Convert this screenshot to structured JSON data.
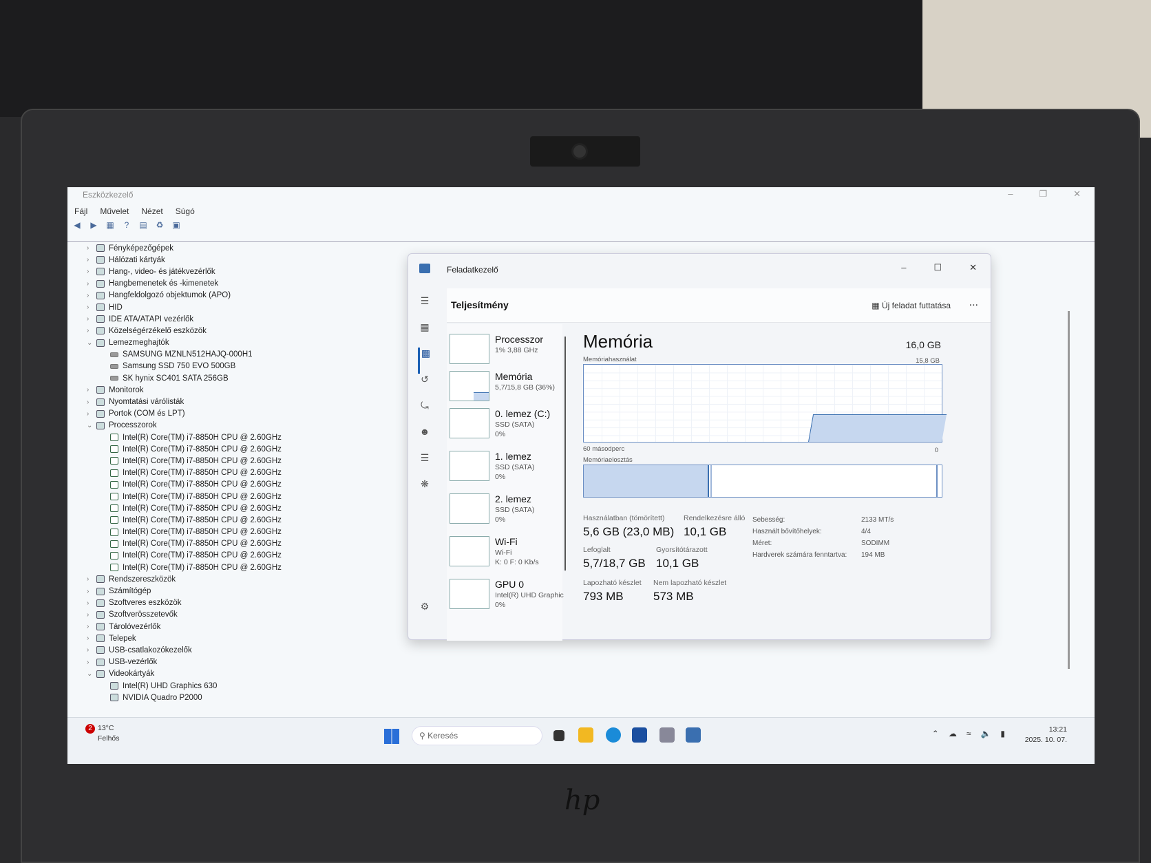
{
  "device_manager": {
    "title": "Eszközkezelő",
    "menu": [
      "Fájl",
      "Művelet",
      "Nézet",
      "Súgó"
    ],
    "tree": [
      {
        "label": "Fényképezőgépek",
        "level": 0,
        "expanded": false
      },
      {
        "label": "Hálózati kártyák",
        "level": 0,
        "expanded": false
      },
      {
        "label": "Hang-, video- és játékvezérlők",
        "level": 0,
        "expanded": false
      },
      {
        "label": "Hangbemenetek és -kimenetek",
        "level": 0,
        "expanded": false
      },
      {
        "label": "Hangfeldolgozó objektumok (APO)",
        "level": 0,
        "expanded": false
      },
      {
        "label": "HID",
        "level": 0,
        "expanded": false
      },
      {
        "label": "IDE ATA/ATAPI vezérlők",
        "level": 0,
        "expanded": false
      },
      {
        "label": "Közelségérzékelő eszközök",
        "level": 0,
        "expanded": false
      },
      {
        "label": "Lemezmeghajtók",
        "level": 0,
        "expanded": true
      },
      {
        "label": "SAMSUNG MZNLN512HAJQ-000H1",
        "level": 1,
        "icon": "disk"
      },
      {
        "label": "Samsung SSD 750 EVO 500GB",
        "level": 1,
        "icon": "disk"
      },
      {
        "label": "SK hynix SC401 SATA 256GB",
        "level": 1,
        "icon": "disk"
      },
      {
        "label": "Monitorok",
        "level": 0,
        "expanded": false
      },
      {
        "label": "Nyomtatási várólisták",
        "level": 0,
        "expanded": false
      },
      {
        "label": "Portok (COM és LPT)",
        "level": 0,
        "expanded": false
      },
      {
        "label": "Processzorok",
        "level": 0,
        "expanded": true
      },
      {
        "label": "Intel(R) Core(TM) i7-8850H CPU @ 2.60GHz",
        "level": 1,
        "icon": "cpu"
      },
      {
        "label": "Intel(R) Core(TM) i7-8850H CPU @ 2.60GHz",
        "level": 1,
        "icon": "cpu"
      },
      {
        "label": "Intel(R) Core(TM) i7-8850H CPU @ 2.60GHz",
        "level": 1,
        "icon": "cpu"
      },
      {
        "label": "Intel(R) Core(TM) i7-8850H CPU @ 2.60GHz",
        "level": 1,
        "icon": "cpu"
      },
      {
        "label": "Intel(R) Core(TM) i7-8850H CPU @ 2.60GHz",
        "level": 1,
        "icon": "cpu"
      },
      {
        "label": "Intel(R) Core(TM) i7-8850H CPU @ 2.60GHz",
        "level": 1,
        "icon": "cpu"
      },
      {
        "label": "Intel(R) Core(TM) i7-8850H CPU @ 2.60GHz",
        "level": 1,
        "icon": "cpu"
      },
      {
        "label": "Intel(R) Core(TM) i7-8850H CPU @ 2.60GHz",
        "level": 1,
        "icon": "cpu"
      },
      {
        "label": "Intel(R) Core(TM) i7-8850H CPU @ 2.60GHz",
        "level": 1,
        "icon": "cpu"
      },
      {
        "label": "Intel(R) Core(TM) i7-8850H CPU @ 2.60GHz",
        "level": 1,
        "icon": "cpu"
      },
      {
        "label": "Intel(R) Core(TM) i7-8850H CPU @ 2.60GHz",
        "level": 1,
        "icon": "cpu"
      },
      {
        "label": "Intel(R) Core(TM) i7-8850H CPU @ 2.60GHz",
        "level": 1,
        "icon": "cpu"
      },
      {
        "label": "Rendszereszközök",
        "level": 0,
        "expanded": false
      },
      {
        "label": "Számítógép",
        "level": 0,
        "expanded": false
      },
      {
        "label": "Szoftveres eszközök",
        "level": 0,
        "expanded": false
      },
      {
        "label": "Szoftverösszetevők",
        "level": 0,
        "expanded": false
      },
      {
        "label": "Tárolóvezérlők",
        "level": 0,
        "expanded": false
      },
      {
        "label": "Telepek",
        "level": 0,
        "expanded": false
      },
      {
        "label": "USB-csatlakozókezelők",
        "level": 0,
        "expanded": false
      },
      {
        "label": "USB-vezérlők",
        "level": 0,
        "expanded": false
      },
      {
        "label": "Videokártyák",
        "level": 0,
        "expanded": true
      },
      {
        "label": "Intel(R) UHD Graphics 630",
        "level": 1,
        "icon": "monitor"
      },
      {
        "label": "NVIDIA Quadro P2000",
        "level": 1,
        "icon": "monitor"
      }
    ]
  },
  "task_manager": {
    "title": "Feladatkezelő",
    "section_title": "Teljesítmény",
    "run_task_label": "Új feladat futtatása",
    "more": "...",
    "items": [
      {
        "name": "Processzor",
        "sub1": "1% 3,88 GHz",
        "sub2": ""
      },
      {
        "name": "Memória",
        "sub1": "5,7/15,8 GB (36%)",
        "sub2": ""
      },
      {
        "name": "0. lemez (C:)",
        "sub1": "SSD (SATA)",
        "sub2": "0%"
      },
      {
        "name": "1. lemez",
        "sub1": "SSD (SATA)",
        "sub2": "0%"
      },
      {
        "name": "2. lemez",
        "sub1": "SSD (SATA)",
        "sub2": "0%"
      },
      {
        "name": "Wi-Fi",
        "sub1": "Wi-Fi",
        "sub2": "K: 0 F: 0 Kb/s"
      },
      {
        "name": "GPU 0",
        "sub1": "Intel(R) UHD Graphic",
        "sub2": "0%"
      }
    ],
    "memory": {
      "title": "Memória",
      "total": "16,0 GB",
      "usage_label": "Memóriahasználat",
      "usage_max": "15,8 GB",
      "time_label": "60 másodperc",
      "zero": "0",
      "composition_label": "Memóriaelosztás",
      "usage_fraction": 0.36,
      "stats": {
        "in_use_label": "Használatban (tömörített)",
        "in_use_value": "5,6 GB (23,0 MB)",
        "available_label": "Rendelkezésre álló",
        "available_value": "10,1 GB",
        "committed_label": "Lefoglalt",
        "committed_value": "5,7/18,7 GB",
        "cached_label": "Gyorsítótárazott",
        "cached_value": "10,1 GB",
        "paged_label": "Lapozható készlet",
        "paged_value": "793 MB",
        "nonpaged_label": "Nem lapozható készlet",
        "nonpaged_value": "573 MB"
      },
      "details": [
        {
          "k": "Sebesség:",
          "v": "2133 MT/s"
        },
        {
          "k": "Használt bővítőhelyek:",
          "v": "4/4"
        },
        {
          "k": "Méret:",
          "v": "SODIMM"
        },
        {
          "k": "Hardverek számára fenntartva:",
          "v": "194 MB"
        }
      ]
    }
  },
  "taskbar": {
    "weather_badge": "2",
    "temperature": "13°C",
    "condition": "Felhős",
    "search_placeholder": "Keresés",
    "time": "13:21",
    "date": "2025. 10. 07."
  },
  "brand": "hp"
}
